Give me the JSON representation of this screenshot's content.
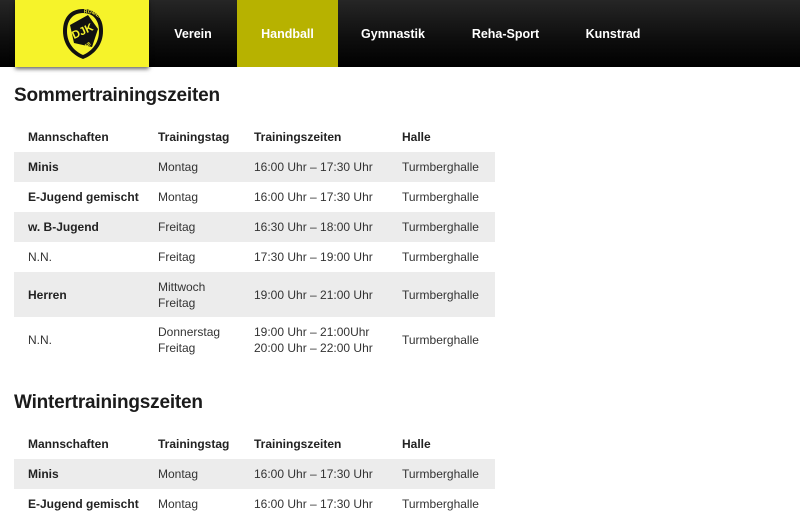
{
  "logo": {
    "text_top": "DJK",
    "text_arc": "RÖMERBACH",
    "text_year": "1958",
    "brand_color": "#f6f32a",
    "accent_color": "#b7b200"
  },
  "nav": {
    "items": [
      {
        "label": "Verein"
      },
      {
        "label": "Handball"
      },
      {
        "label": "Gymnastik"
      },
      {
        "label": "Reha-Sport"
      },
      {
        "label": "Kunstrad"
      }
    ],
    "active": "Handball"
  },
  "summer": {
    "title": "Sommertrainingszeiten",
    "headers": [
      "Mannschaften",
      "Trainingstag",
      "Trainingszeiten",
      "Halle"
    ],
    "rows": [
      {
        "team": "Minis",
        "day": "Montag",
        "day2": "",
        "time": "16:00 Uhr – 17:30 Uhr",
        "time2": "",
        "hall": "Turmberghalle"
      },
      {
        "team": "E-Jugend gemischt",
        "day": "Montag",
        "day2": "",
        "time": "16:00 Uhr – 17:30 Uhr",
        "time2": "",
        "hall": "Turmberghalle"
      },
      {
        "team": "w. B-Jugend",
        "day": "Freitag",
        "day2": "",
        "time": "16:30 Uhr – 18:00 Uhr",
        "time2": "",
        "hall": "Turmberghalle"
      },
      {
        "team": "N.N.",
        "day": "Freitag",
        "day2": "",
        "time": "17:30 Uhr – 19:00 Uhr",
        "time2": "",
        "hall": "Turmberghalle"
      },
      {
        "team": "Herren",
        "day": "Mittwoch",
        "day2": "Freitag",
        "time": "19:00 Uhr – 21:00 Uhr",
        "time2": "",
        "hall": "Turmberghalle"
      },
      {
        "team": "N.N.",
        "day": "Donnerstag",
        "day2": "Freitag",
        "time": "19:00 Uhr – 21:00Uhr",
        "time2": "20:00 Uhr – 22:00 Uhr",
        "hall": "Turmberghalle"
      }
    ]
  },
  "winter": {
    "title": "Wintertrainingszeiten",
    "headers": [
      "Mannschaften",
      "Trainingstag",
      "Trainingszeiten",
      "Halle"
    ],
    "rows": [
      {
        "team": "Minis",
        "day": "Montag",
        "time": "16:00 Uhr – 17:30 Uhr",
        "hall": "Turmberghalle"
      },
      {
        "team": "E-Jugend gemischt",
        "day": "Montag",
        "time": "16:00 Uhr – 17:30 Uhr",
        "hall": "Turmberghalle"
      }
    ]
  }
}
